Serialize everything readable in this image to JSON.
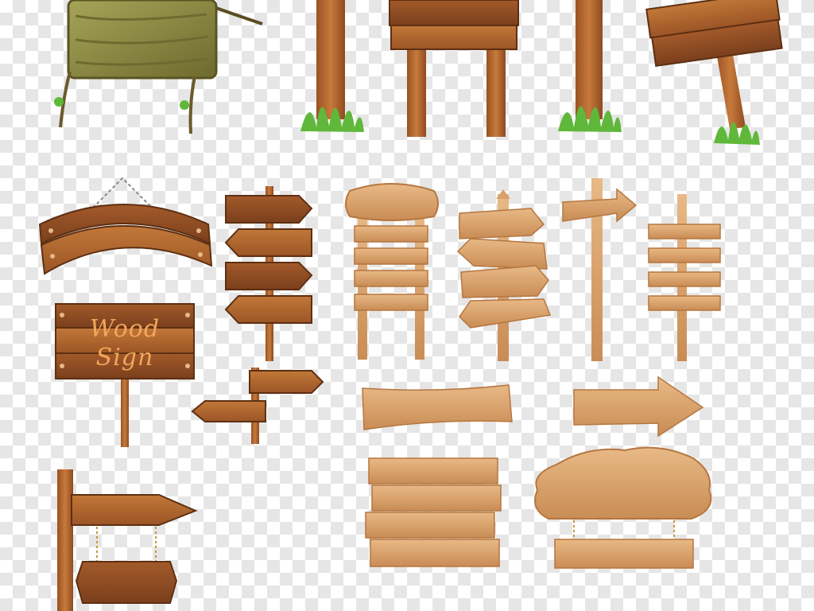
{
  "canvas": {
    "background": "transparency-checkerboard"
  },
  "colors": {
    "wood_dark": "#8b4a22",
    "wood_mid": "#b2662f",
    "wood_light": "#d9a06a",
    "wood_pale": "#e7b888",
    "moss": "#8c8a3c",
    "grass": "#5fb83a",
    "sign_text": "#f2a65a"
  },
  "sign_label": {
    "line1": "Wood",
    "line2": "Sign"
  }
}
